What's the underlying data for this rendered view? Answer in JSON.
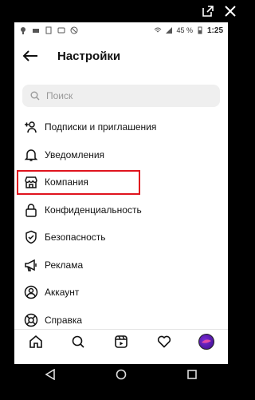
{
  "status": {
    "battery": "45 %",
    "time": "1:25"
  },
  "header": {
    "title": "Настройки"
  },
  "search": {
    "placeholder": "Поиск"
  },
  "menu": [
    {
      "label": "Подписки и приглашения",
      "icon": "add-person-icon"
    },
    {
      "label": "Уведомления",
      "icon": "bell-icon"
    },
    {
      "label": "Компания",
      "icon": "store-icon"
    },
    {
      "label": "Конфиденциальность",
      "icon": "lock-icon"
    },
    {
      "label": "Безопасность",
      "icon": "shield-icon"
    },
    {
      "label": "Реклама",
      "icon": "megaphone-icon"
    },
    {
      "label": "Аккаунт",
      "icon": "account-icon"
    },
    {
      "label": "Справка",
      "icon": "help-icon"
    }
  ],
  "colors": {
    "highlight": "#e0141e"
  }
}
